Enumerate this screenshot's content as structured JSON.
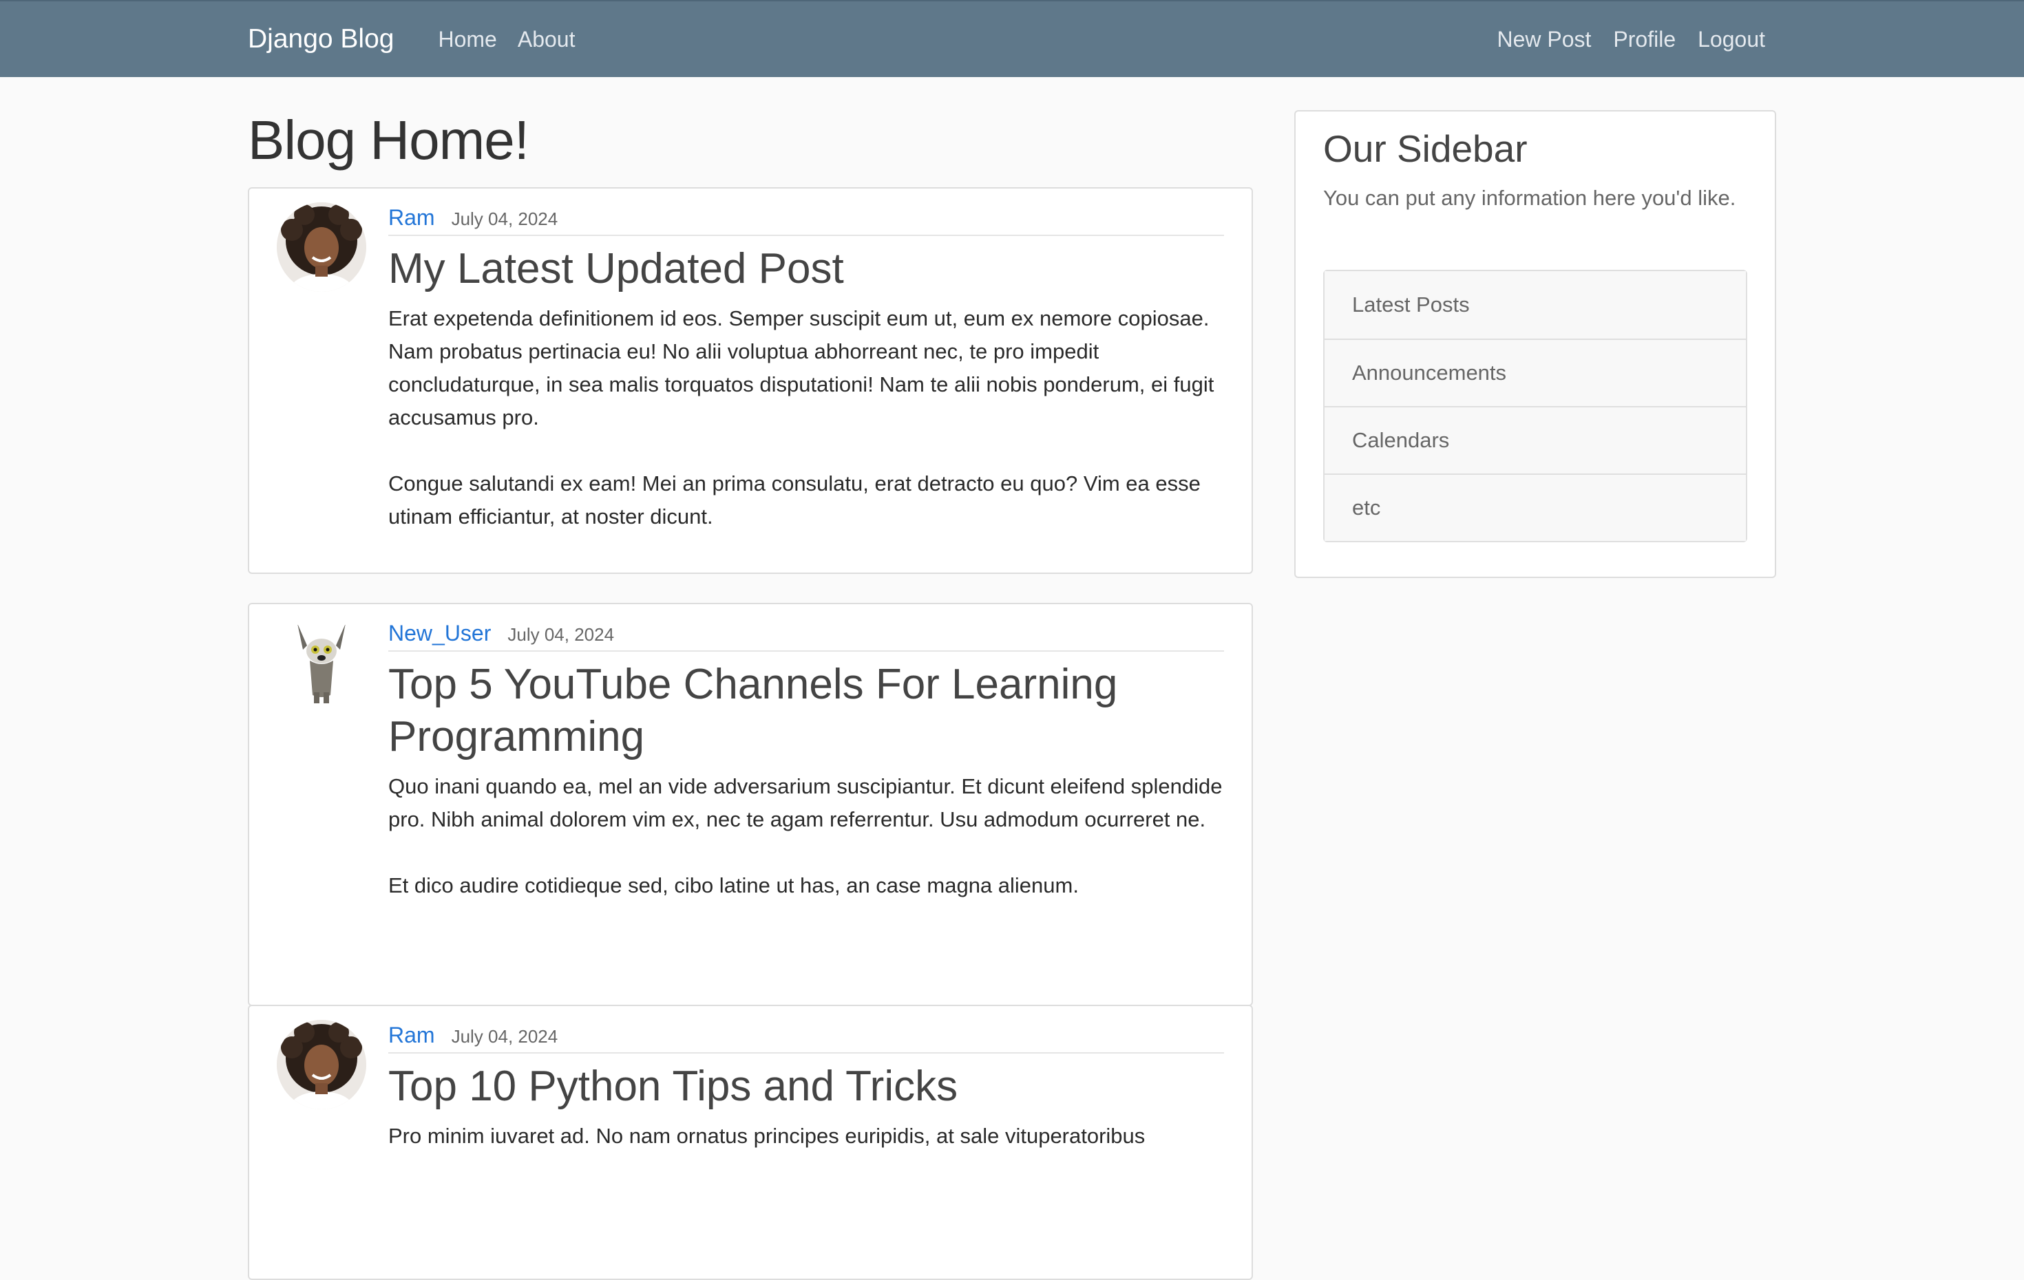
{
  "nav": {
    "brand": "Django Blog",
    "left_links": [
      "Home",
      "About"
    ],
    "right_links": [
      "New Post",
      "Profile",
      "Logout"
    ]
  },
  "main": {
    "title": "Blog Home!"
  },
  "posts": [
    {
      "author": "Ram",
      "date": "July 04, 2024",
      "title": "My Latest Updated Post",
      "paragraphs": [
        "Erat expetenda definitionem id eos. Semper suscipit eum ut, eum ex nemore copiosae. Nam probatus pertinacia eu! No alii voluptua abhorreant nec, te pro impedit concludaturque, in sea malis torquatos disputationi! Nam te alii nobis ponderum, ei fugit accusamus pro.",
        "Congue salutandi ex eam! Mei an prima consulatu, erat detracto eu quo? Vim ea esse utinam efficiantur, at noster dicunt."
      ]
    },
    {
      "author": "New_User",
      "date": "July 04, 2024",
      "title": "Top 5 YouTube Channels For Learning Programming",
      "paragraphs": [
        "Quo inani quando ea, mel an vide adversarium suscipiantur. Et dicunt eleifend splendide pro. Nibh animal dolorem vim ex, nec te agam referrentur. Usu admodum ocurreret ne.",
        "Et dico audire cotidieque sed, cibo latine ut has, an case magna alienum."
      ]
    },
    {
      "author": "Ram",
      "date": "July 04, 2024",
      "title": "Top 10 Python Tips and Tricks",
      "paragraphs": [
        "Pro minim iuvaret ad. No nam ornatus principes euripidis, at sale vituperatoribus"
      ]
    }
  ],
  "sidebar": {
    "title": "Our Sidebar",
    "description": "You can put any information here you'd like.",
    "items": [
      "Latest Posts",
      "Announcements",
      "Calendars",
      "etc"
    ]
  }
}
